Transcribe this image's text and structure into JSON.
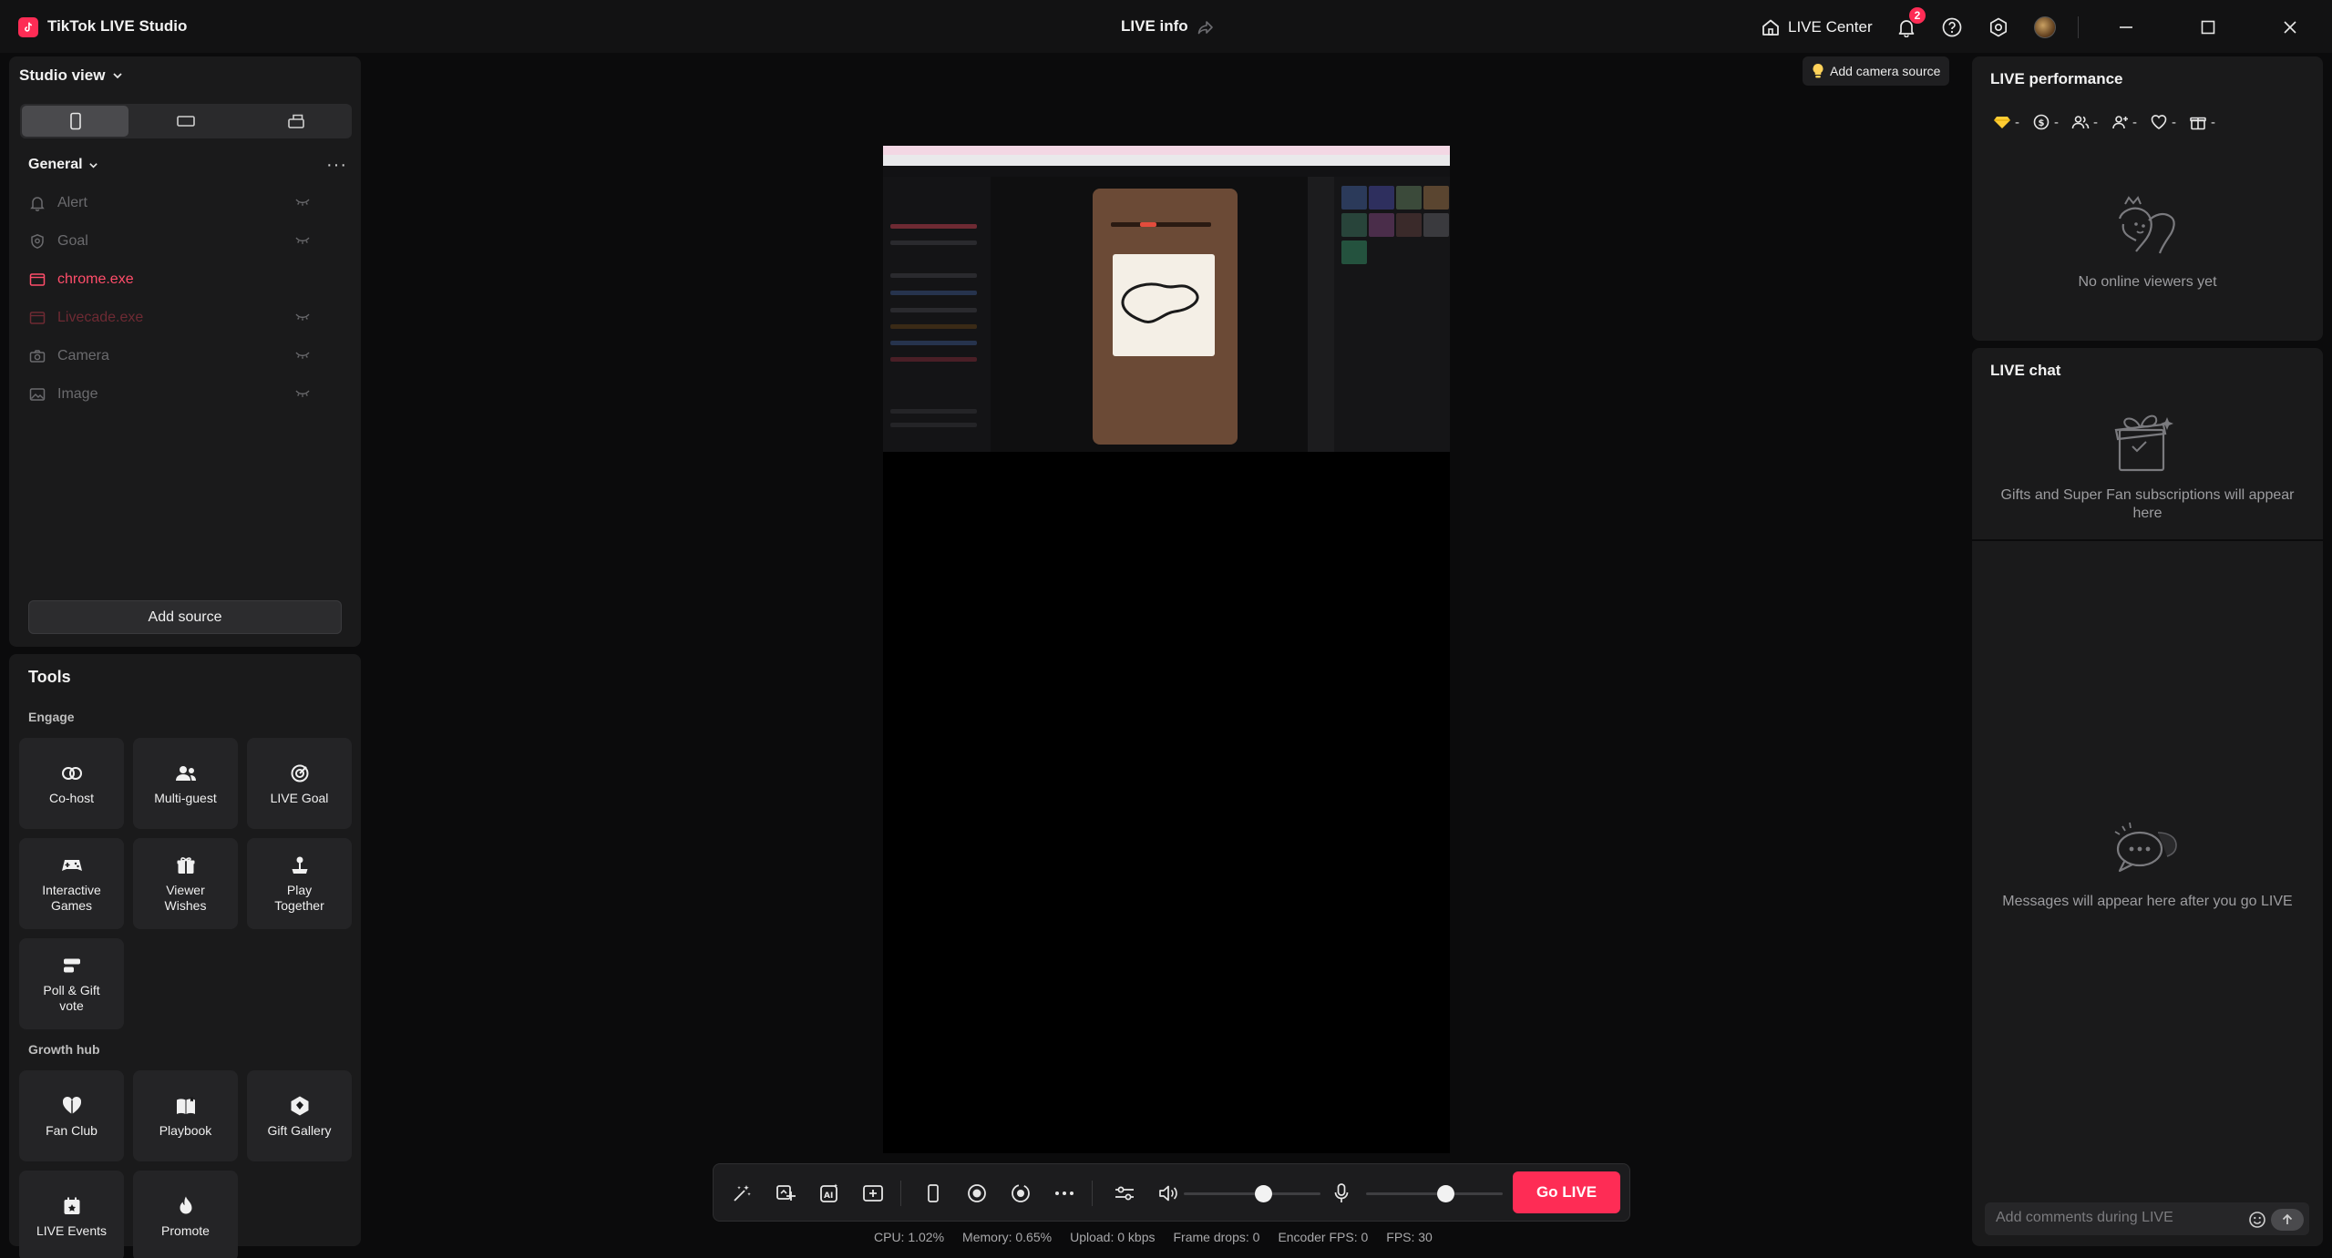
{
  "titlebar": {
    "app_name": "TikTok LIVE Studio",
    "center_title": "LIVE info",
    "live_center_label": "LIVE Center",
    "notification_count": "2"
  },
  "studio": {
    "view_label": "Studio view",
    "general_label": "General",
    "sources": [
      {
        "label": "Alert",
        "state": "hidden"
      },
      {
        "label": "Goal",
        "state": "hidden"
      },
      {
        "label": "chrome.exe",
        "state": "active"
      },
      {
        "label": "Livecade.exe",
        "state": "hidden"
      },
      {
        "label": "Camera",
        "state": "hidden"
      },
      {
        "label": "Image",
        "state": "hidden"
      }
    ],
    "add_source_label": "Add source"
  },
  "tools": {
    "title": "Tools",
    "engage_label": "Engage",
    "engage": [
      {
        "label": "Co-host",
        "icon": "cohost-icon"
      },
      {
        "label": "Multi-guest",
        "icon": "multiguest-icon"
      },
      {
        "label": "LIVE Goal",
        "icon": "goal-icon"
      },
      {
        "label": "Interactive\nGames",
        "icon": "gamepad-icon"
      },
      {
        "label": "Viewer\nWishes",
        "icon": "gift-icon"
      },
      {
        "label": "Play\nTogether",
        "icon": "joystick-icon"
      },
      {
        "label": "Poll & Gift\nvote",
        "icon": "poll-icon"
      }
    ],
    "growth_label": "Growth hub",
    "growth": [
      {
        "label": "Fan Club",
        "icon": "heart-icon"
      },
      {
        "label": "Playbook",
        "icon": "book-icon"
      },
      {
        "label": "Gift Gallery",
        "icon": "gallery-icon"
      },
      {
        "label": "LIVE Events",
        "icon": "calendar-icon"
      },
      {
        "label": "Promote",
        "icon": "flame-icon"
      }
    ]
  },
  "preview": {
    "camera_hint": "Add camera source"
  },
  "controls": {
    "go_live_label": "Go LIVE",
    "volume_level": 0.58,
    "mic_level": 0.58
  },
  "stats": {
    "cpu": "CPU:  1.02%",
    "memory": "Memory:  0.65%",
    "upload": "Upload:  0 kbps",
    "frame_drops": "Frame drops:  0",
    "encoder_fps": "Encoder FPS:  0",
    "fps": "FPS:  30"
  },
  "performance": {
    "title": "LIVE performance",
    "metrics": [
      {
        "icon": "diamond-icon",
        "value": "-"
      },
      {
        "icon": "coin-icon",
        "value": "-"
      },
      {
        "icon": "viewers-icon",
        "value": "-"
      },
      {
        "icon": "new-follower-icon",
        "value": "-"
      },
      {
        "icon": "like-icon",
        "value": "-"
      },
      {
        "icon": "gift-box-icon",
        "value": "-"
      }
    ],
    "empty_text": "No online viewers yet"
  },
  "chat": {
    "title": "LIVE chat",
    "gifts_empty": "Gifts and Super Fan subscriptions will appear here",
    "messages_empty": "Messages will appear here after you go LIVE",
    "input_placeholder": "Add comments during LIVE"
  },
  "colors": {
    "accent": "#fe2c55",
    "panel": "#1a1a1b",
    "background": "#0b0b0c"
  }
}
